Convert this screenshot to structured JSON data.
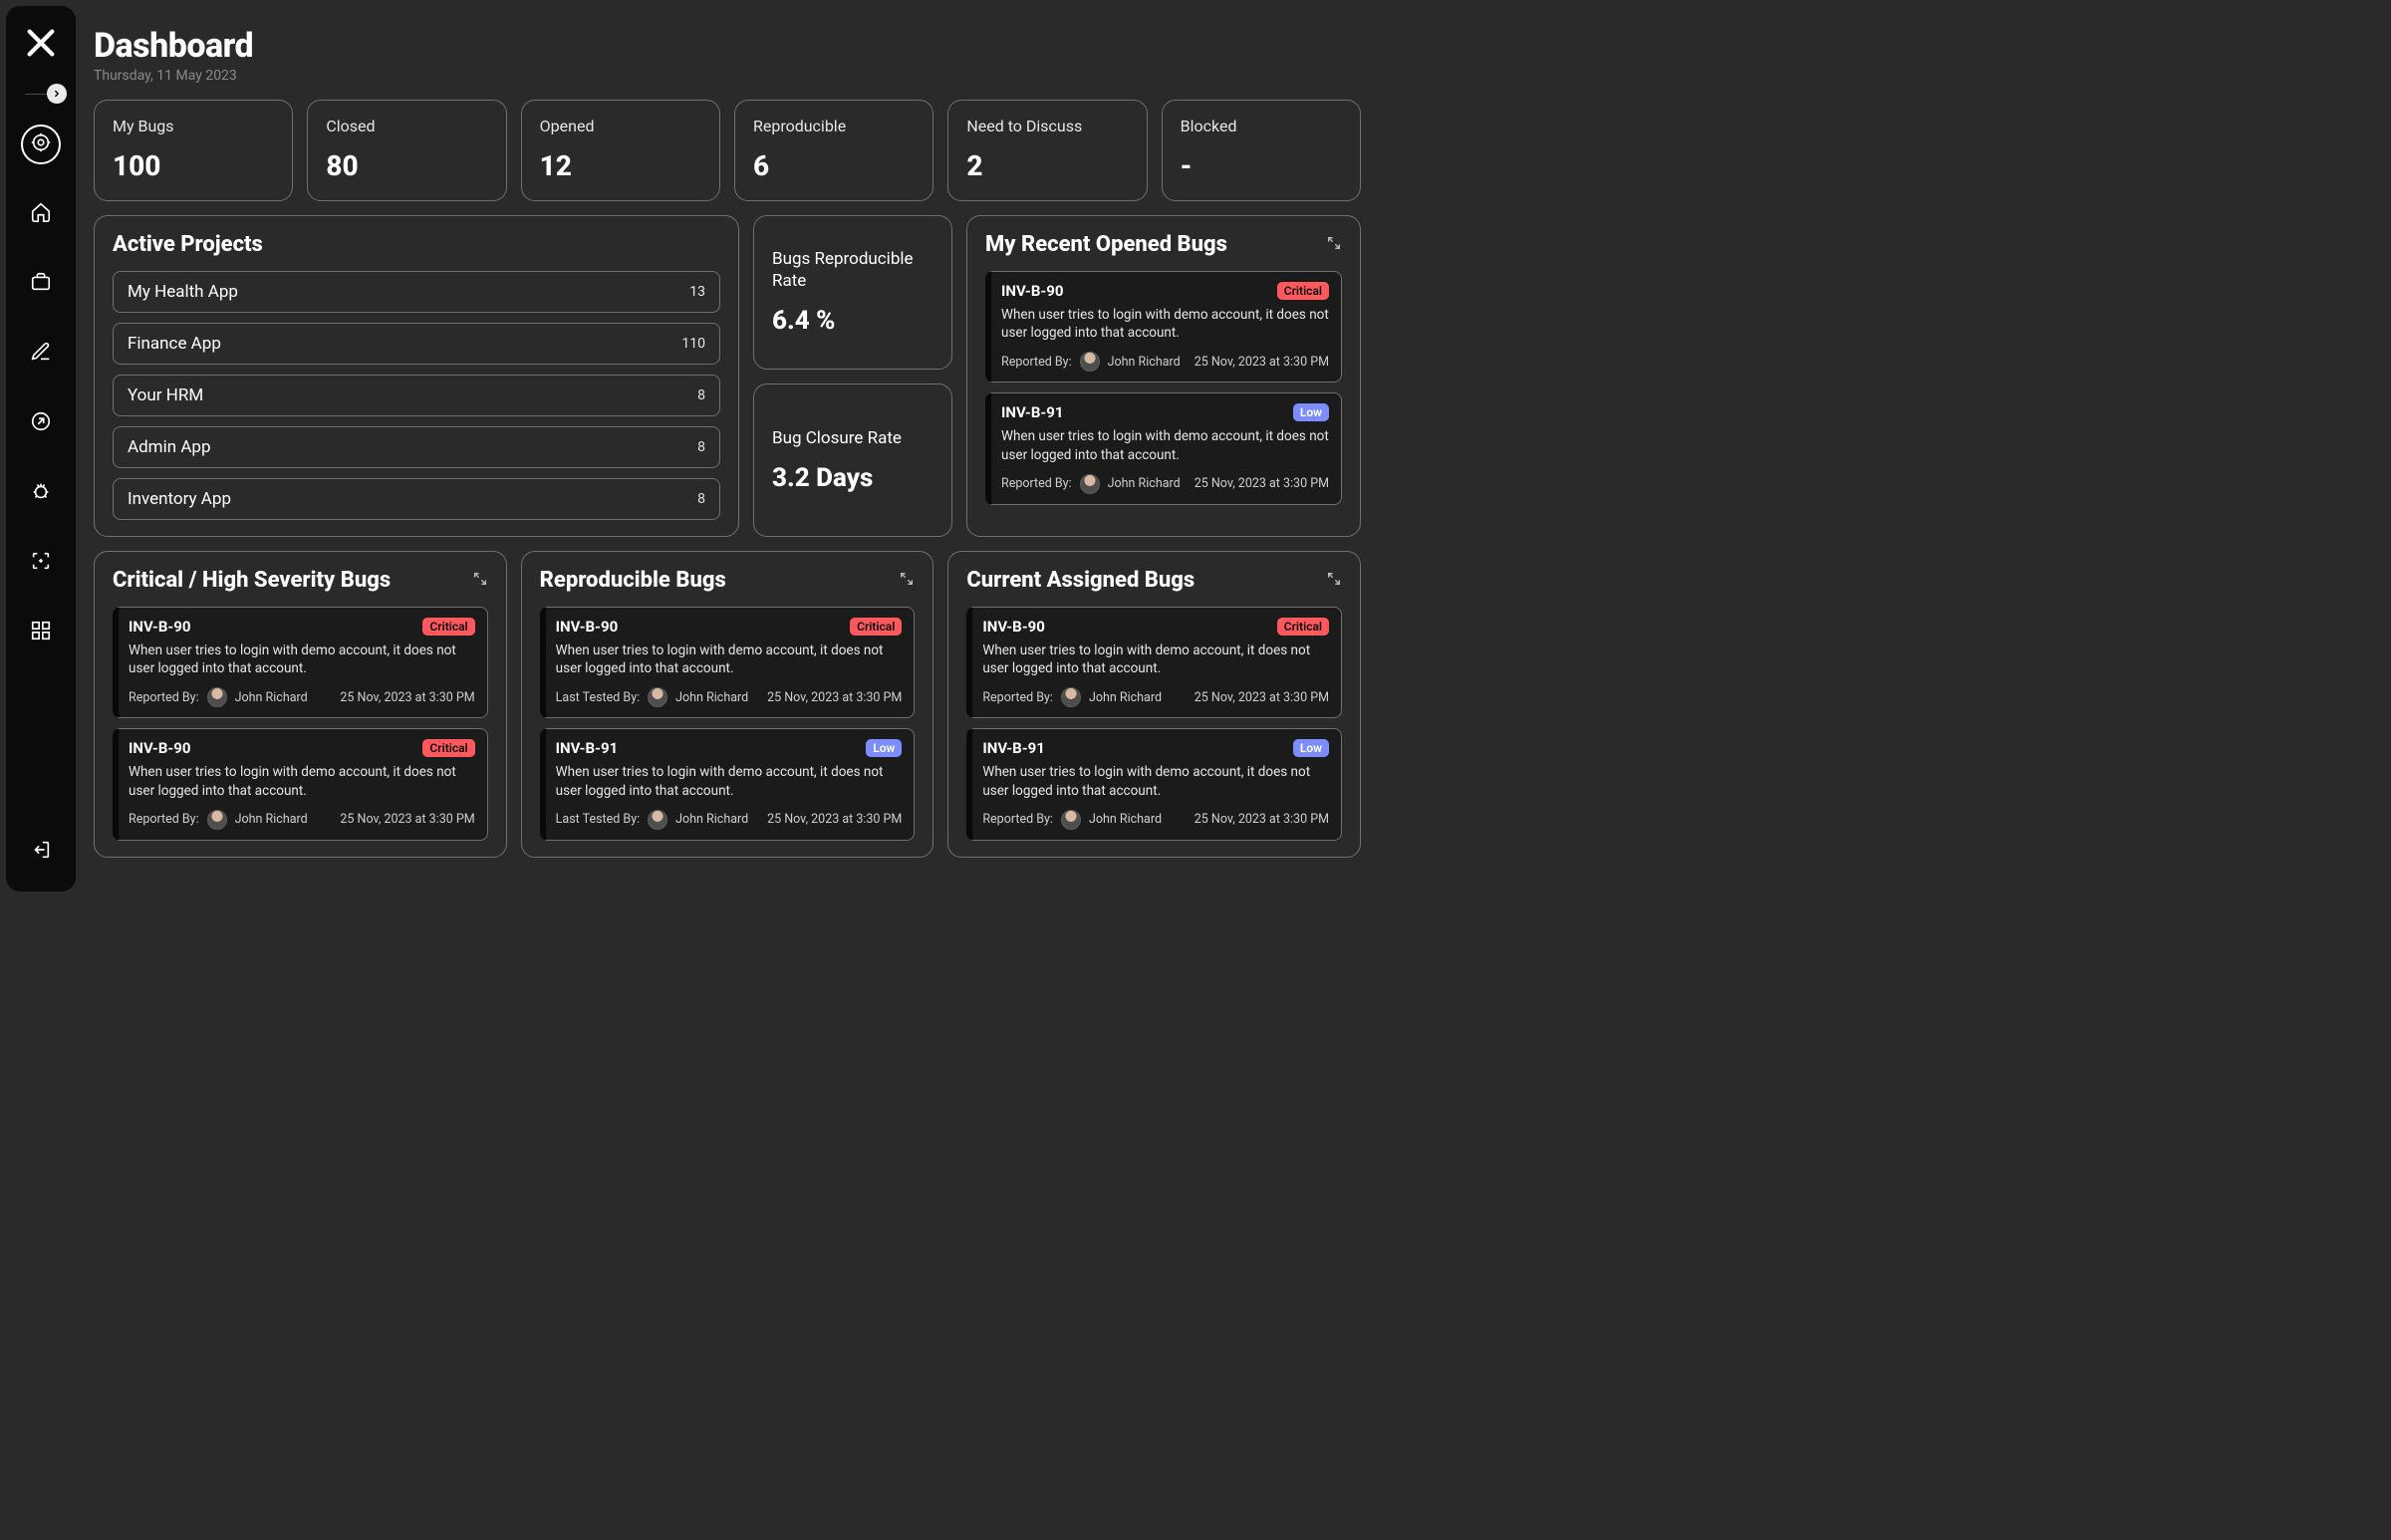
{
  "header": {
    "title": "Dashboard",
    "date": "Thursday, 11 May 2023"
  },
  "stats": [
    {
      "label": "My Bugs",
      "value": "100"
    },
    {
      "label": "Closed",
      "value": "80"
    },
    {
      "label": "Opened",
      "value": "12"
    },
    {
      "label": "Reproducible",
      "value": "6"
    },
    {
      "label": "Need to Discuss",
      "value": "2"
    },
    {
      "label": "Blocked",
      "value": "-"
    }
  ],
  "activeProjects": {
    "title": "Active Projects",
    "items": [
      {
        "name": "My Health App",
        "count": "13"
      },
      {
        "name": "Finance App",
        "count": "110"
      },
      {
        "name": "Your HRM",
        "count": "8"
      },
      {
        "name": "Admin App",
        "count": "8"
      },
      {
        "name": "Inventory App",
        "count": "8"
      }
    ]
  },
  "rates": {
    "reproducible": {
      "label": "Bugs Reproducible Rate",
      "value": "6.4 %"
    },
    "closure": {
      "label": "Bug Closure Rate",
      "value": "3.2 Days"
    }
  },
  "labels": {
    "reportedBy": "Reported By:",
    "lastTestedBy": "Last Tested By:"
  },
  "recentOpened": {
    "title": "My Recent Opened Bugs",
    "items": [
      {
        "id": "INV-B-90",
        "severity": "Critical",
        "severityClass": "critical",
        "desc": "When user tries to login with demo account, it does not user logged into that account.",
        "reporter": "John Richard",
        "time": "25 Nov, 2023 at 3:30 PM"
      },
      {
        "id": "INV-B-91",
        "severity": "Low",
        "severityClass": "low",
        "desc": "When user tries to login with demo account, it does not user logged into that account.",
        "reporter": "John Richard",
        "time": "25 Nov, 2023 at 3:30 PM"
      }
    ]
  },
  "criticalBugs": {
    "title": "Critical / High Severity Bugs",
    "items": [
      {
        "id": "INV-B-90",
        "severity": "Critical",
        "severityClass": "critical",
        "desc": "When user tries to login with demo account, it does not user logged into that account.",
        "reporter": "John Richard",
        "time": "25 Nov, 2023 at 3:30 PM"
      },
      {
        "id": "INV-B-90",
        "severity": "Critical",
        "severityClass": "critical",
        "desc": "When user tries to login with demo account, it does not user logged into that account.",
        "reporter": "John Richard",
        "time": "25 Nov, 2023 at 3:30 PM"
      }
    ]
  },
  "reproducibleBugs": {
    "title": "Reproducible Bugs",
    "items": [
      {
        "id": "INV-B-90",
        "severity": "Critical",
        "severityClass": "critical",
        "desc": "When user tries to login with demo account, it does not user logged into that account.",
        "reporter": "John Richard",
        "time": "25 Nov, 2023 at 3:30 PM"
      },
      {
        "id": "INV-B-91",
        "severity": "Low",
        "severityClass": "low",
        "desc": "When user tries to login with demo account, it does not user logged into that account.",
        "reporter": "John Richard",
        "time": "25 Nov, 2023 at 3:30 PM"
      }
    ]
  },
  "assignedBugs": {
    "title": "Current Assigned Bugs",
    "items": [
      {
        "id": "INV-B-90",
        "severity": "Critical",
        "severityClass": "critical",
        "desc": "When user tries to login with demo account, it does not user logged into that account.",
        "reporter": "John Richard",
        "time": "25 Nov, 2023 at 3:30 PM"
      },
      {
        "id": "INV-B-91",
        "severity": "Low",
        "severityClass": "low",
        "desc": "When user tries to login with demo account, it does not user logged into that account.",
        "reporter": "John Richard",
        "time": "25 Nov, 2023 at 3:30 PM"
      }
    ]
  }
}
